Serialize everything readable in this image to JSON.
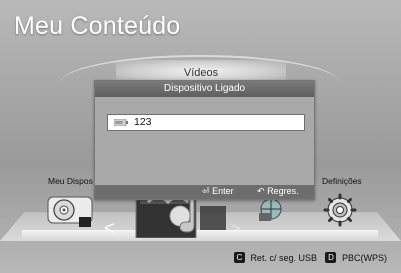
{
  "screen": {
    "title": "Meu Conteúdo",
    "current_tab": "Vídeos"
  },
  "side_items": {
    "left": "Meu Dispos",
    "right": "Definições"
  },
  "dialog": {
    "title": "Dispositivo Ligado",
    "device_name": "123",
    "enter_label": "Enter",
    "back_label": "Regres."
  },
  "hints": {
    "c_badge": "C",
    "c_label": "Ret. c/ seg. USB",
    "d_badge": "D",
    "d_label": "PBC(WPS)"
  },
  "icons": {
    "carousel_prev": "<",
    "carousel_next": ">"
  }
}
